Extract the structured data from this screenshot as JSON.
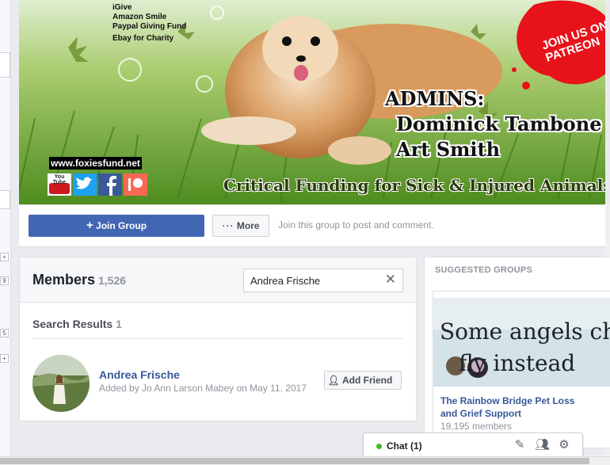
{
  "cover": {
    "fund_lines": [
      "iGive",
      "Amazon Smile",
      "Paypal Giving Fund",
      "Ebay for Charity"
    ],
    "patreon_badge": "JOIN US ON PATREON",
    "admins_label": "ADMINS:",
    "admin_names": [
      "Dominick Tambone",
      "Art Smith"
    ],
    "website": "www.foxiesfund.net",
    "social_icons": [
      "youtube-icon",
      "twitter-icon",
      "facebook-icon",
      "patreon-icon"
    ],
    "youtube_text": "You Tube",
    "tagline": "Critical Funding for Sick & Injured Animals"
  },
  "actions": {
    "join_label": "Join Group",
    "more_label": "More",
    "hint": "Join this group to post and comment."
  },
  "members": {
    "title": "Members",
    "count": "1,526",
    "search_value": "Andrea Frische",
    "results_label": "Search Results",
    "results_count": "1",
    "results": [
      {
        "name": "Andrea Frische",
        "added_by": "Added by Jo Ann Larson Mabey on May 11, 2017",
        "action_label": "Add Friend"
      }
    ]
  },
  "suggested": {
    "title": "SUGGESTED GROUPS",
    "image_text_line1": "Some angels choo",
    "image_text_line2": "fly instead",
    "group_name": "The Rainbow Bridge Pet Loss and Grief Support",
    "group_members": "19,195 members"
  },
  "chat": {
    "label": "Chat (1)"
  },
  "colors": {
    "brand_blue": "#4267b2",
    "link_blue": "#365899",
    "page_bg": "#e9ebee",
    "online_green": "#42b72a",
    "patreon_red": "#e8121a"
  }
}
